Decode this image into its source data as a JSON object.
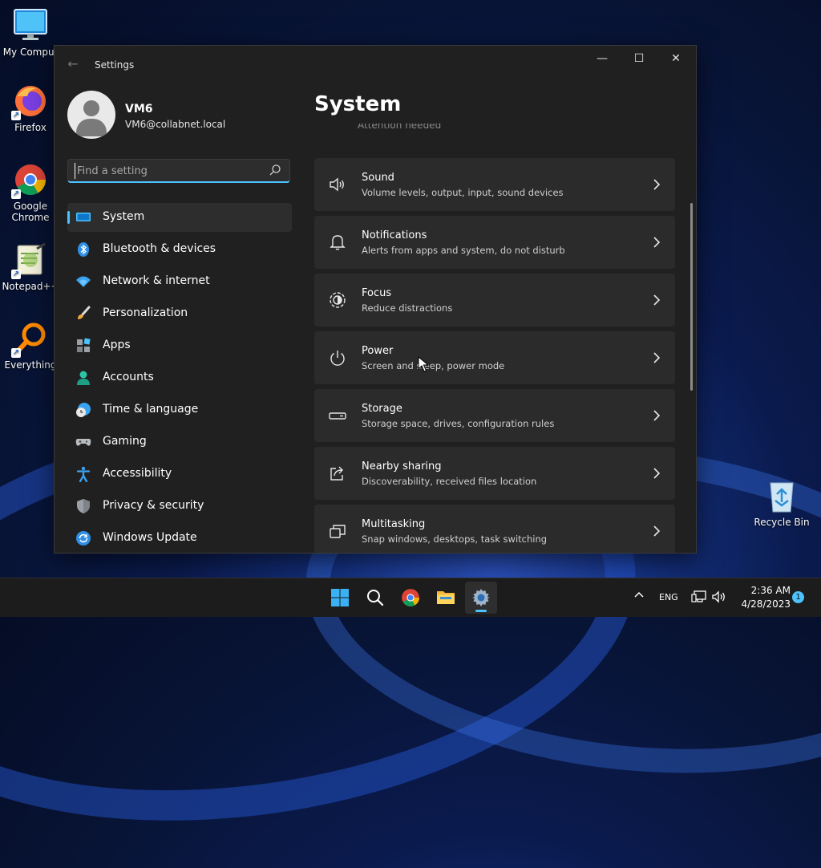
{
  "desktop": {
    "icons": [
      {
        "label": "My Comput"
      },
      {
        "label": "Firefox"
      },
      {
        "label": "Google Chrome"
      },
      {
        "label": "Notepad++"
      },
      {
        "label": "Everything"
      },
      {
        "label": "Recycle Bin"
      }
    ]
  },
  "window": {
    "title": "Settings",
    "back_icon": "back-arrow-icon",
    "minimize_glyph": "—",
    "maximize_glyph": "☐",
    "close_glyph": "✕"
  },
  "profile": {
    "name": "VM6",
    "email": "VM6@collabnet.local"
  },
  "search": {
    "placeholder": "Find a setting",
    "value": ""
  },
  "nav": {
    "items": [
      {
        "label": "System",
        "icon": "system-icon",
        "active": true
      },
      {
        "label": "Bluetooth & devices",
        "icon": "bluetooth-icon"
      },
      {
        "label": "Network & internet",
        "icon": "wifi-icon"
      },
      {
        "label": "Personalization",
        "icon": "brush-icon"
      },
      {
        "label": "Apps",
        "icon": "apps-icon"
      },
      {
        "label": "Accounts",
        "icon": "account-icon"
      },
      {
        "label": "Time & language",
        "icon": "clock-globe-icon"
      },
      {
        "label": "Gaming",
        "icon": "gamepad-icon"
      },
      {
        "label": "Accessibility",
        "icon": "accessibility-icon"
      },
      {
        "label": "Privacy & security",
        "icon": "shield-icon"
      },
      {
        "label": "Windows Update",
        "icon": "update-icon"
      }
    ]
  },
  "main": {
    "title": "System",
    "partial_text": "Attention needed",
    "cards": [
      {
        "title": "Sound",
        "subtitle": "Volume levels, output, input, sound devices",
        "icon": "speaker-icon"
      },
      {
        "title": "Notifications",
        "subtitle": "Alerts from apps and system, do not disturb",
        "icon": "bell-icon"
      },
      {
        "title": "Focus",
        "subtitle": "Reduce distractions",
        "icon": "focus-icon"
      },
      {
        "title": "Power",
        "subtitle": "Screen and sleep, power mode",
        "icon": "power-icon"
      },
      {
        "title": "Storage",
        "subtitle": "Storage space, drives, configuration rules",
        "icon": "storage-icon"
      },
      {
        "title": "Nearby sharing",
        "subtitle": "Discoverability, received files location",
        "icon": "share-icon"
      },
      {
        "title": "Multitasking",
        "subtitle": "Snap windows, desktops, task switching",
        "icon": "multitask-icon"
      }
    ]
  },
  "taskbar": {
    "apps": [
      "start-icon",
      "search-icon",
      "chrome-icon",
      "file-explorer-icon",
      "settings-icon"
    ],
    "tray": {
      "language": "ENG",
      "time": "2:36 AM",
      "date": "4/28/2023",
      "notification_count": "1"
    }
  },
  "colors": {
    "accent": "#4cc2ff",
    "window_bg": "#202020",
    "card_bg": "#2b2b2b"
  }
}
